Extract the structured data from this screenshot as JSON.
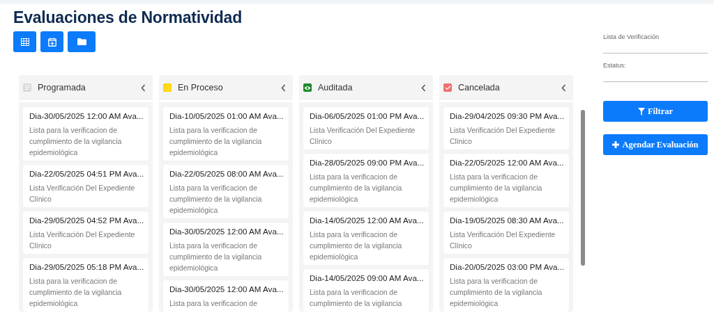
{
  "title": "Evaluaciones de Normatividad",
  "toolbar": [
    {
      "kind": "grid"
    },
    {
      "kind": "calendar"
    },
    {
      "kind": "folder"
    }
  ],
  "columns": [
    {
      "name": "Programada",
      "kind": "lines",
      "color": "#d9d9d9",
      "cards": [
        {
          "title": "Dia-30/05/2025 12:00 AM Ava...",
          "description": "Lista para la verificacion de cumplimiento de la vigilancia epidemiológica"
        },
        {
          "title": "Dia-22/05/2025 04:51 PM Ava...",
          "description": "Lista Verificación Del Expediente Clínico"
        },
        {
          "title": "Dia-29/05/2025 04:52 PM Ava...",
          "description": "Lista Verificación Del Expediente Clínico"
        },
        {
          "title": "Dia-29/05/2025 05:18 PM Ava...",
          "description": "Lista para la verificacion de cumplimiento de la vigilancia epidemiológica"
        }
      ]
    },
    {
      "name": "En Proceso",
      "kind": "spinner",
      "color": "#ffd500",
      "cards": [
        {
          "title": "Dia-10/05/2025 01:00 AM Ava...",
          "description": "Lista para la verificacion de cumplimiento de la vigilancia epidemiológica"
        },
        {
          "title": "Dia-22/05/2025 08:00 AM Ava...",
          "description": "Lista para la verificacion de cumplimiento de la vigilancia epidemiológica"
        },
        {
          "title": "Dia-30/05/2025 12:00 AM Ava...",
          "description": "Lista para la verificacion de cumplimiento de la vigilancia epidemiológica"
        },
        {
          "title": "Dia-30/05/2025 12:00 AM Ava...",
          "description": "Lista para la verificacion de"
        }
      ]
    },
    {
      "name": "Auditada",
      "kind": "eye",
      "color": "#1e8a2e",
      "cards": [
        {
          "title": "Dia-06/05/2025 01:00 PM Ava...",
          "description": "Lista Verificación Del Expediente Clínico"
        },
        {
          "title": "Dia-28/05/2025 09:00 PM Ava...",
          "description": "Lista para la verificacion de cumplimiento de la vigilancia epidemiológica"
        },
        {
          "title": "Dia-14/05/2025 12:00 AM Ava...",
          "description": "Lista para la verificacion de cumplimiento de la vigilancia epidemiológica"
        },
        {
          "title": "Dia-14/05/2025 09:00 AM Ava...",
          "description": "Lista para la verificacion de cumplimiento de la vigilancia"
        }
      ]
    },
    {
      "name": "Cancelada",
      "kind": "check",
      "color": "#f07070",
      "cards": [
        {
          "title": "Dia-29/04/2025 09:30 PM Ava...",
          "description": "Lista Verificación Del Expediente Clínico"
        },
        {
          "title": "Dia-22/05/2025 12:00 AM Ava...",
          "description": "Lista para la verificacion de cumplimiento de la vigilancia epidemiológica"
        },
        {
          "title": "Dia-19/05/2025 08:30 AM Ava...",
          "description": "Lista Verificación Del Expediente Clínico"
        },
        {
          "title": "Dia-20/05/2025 03:00 PM Ava...",
          "description": "Lista para la verificacion de cumplimiento de la vigilancia epidemiológica"
        }
      ]
    }
  ],
  "filters": [
    {
      "label": "Lista de Verificación"
    },
    {
      "label": "Estatus:"
    }
  ],
  "actions": [
    {
      "label": "Filtrar",
      "kind": "filter"
    },
    {
      "label": "Agendar Evaluación",
      "kind": "plus"
    }
  ]
}
